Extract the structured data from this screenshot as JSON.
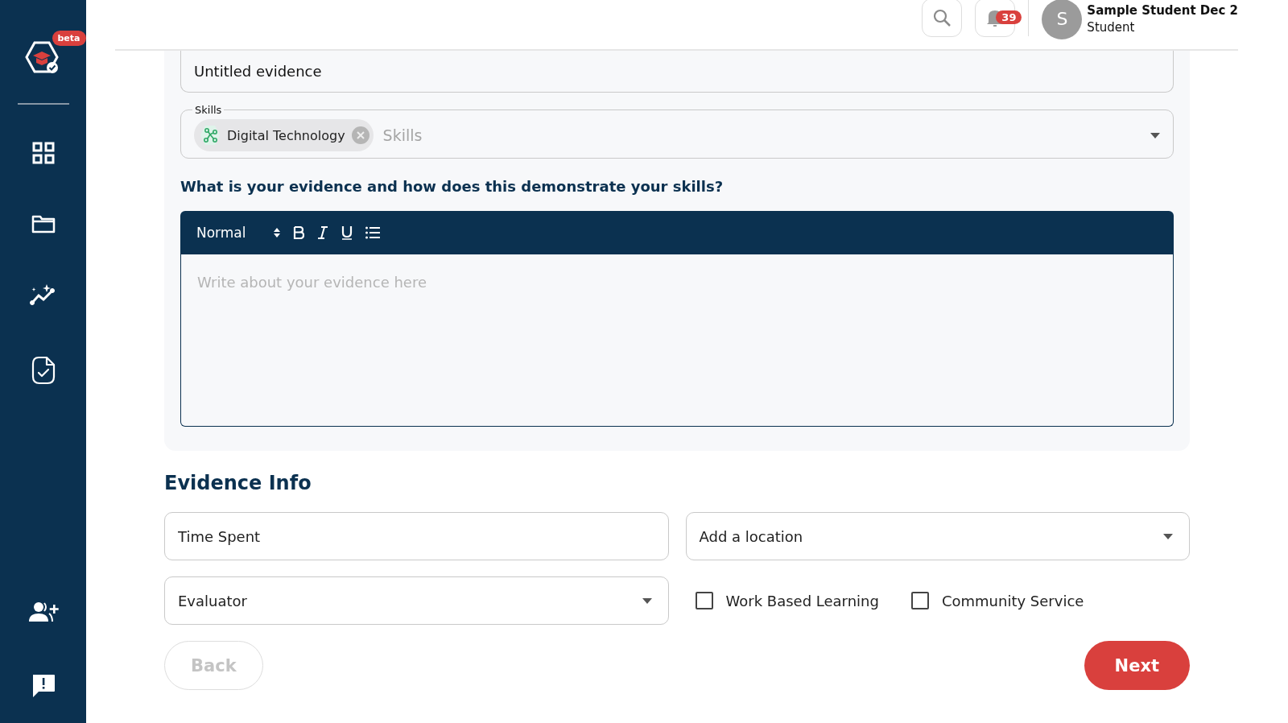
{
  "sidebar": {
    "badge": "beta"
  },
  "header": {
    "notifications_count": "39",
    "user": {
      "initial": "S",
      "name": "Sample Student Dec 2",
      "role": "Student"
    }
  },
  "evidence": {
    "title_value": "Untitled evidence",
    "skills": {
      "label": "Skills",
      "chips": [
        {
          "label": "Digital Technology"
        }
      ],
      "placeholder": "Skills"
    },
    "question": "What is your evidence and how does this demonstrate your skills?",
    "editor": {
      "format": "Normal",
      "placeholder": "Write about your evidence here"
    }
  },
  "evidence_info": {
    "heading": "Evidence Info",
    "time_spent": {
      "placeholder": "Time Spent"
    },
    "location": {
      "placeholder": "Add a location"
    },
    "evaluator": {
      "placeholder": "Evaluator"
    },
    "checkboxes": [
      {
        "label": "Work Based Learning",
        "checked": false
      },
      {
        "label": "Community Service",
        "checked": false
      }
    ]
  },
  "buttons": [
    {
      "label": "Back",
      "kind": "secondary",
      "disabled": true
    },
    {
      "label": "Next",
      "kind": "primary",
      "disabled": false
    }
  ]
}
